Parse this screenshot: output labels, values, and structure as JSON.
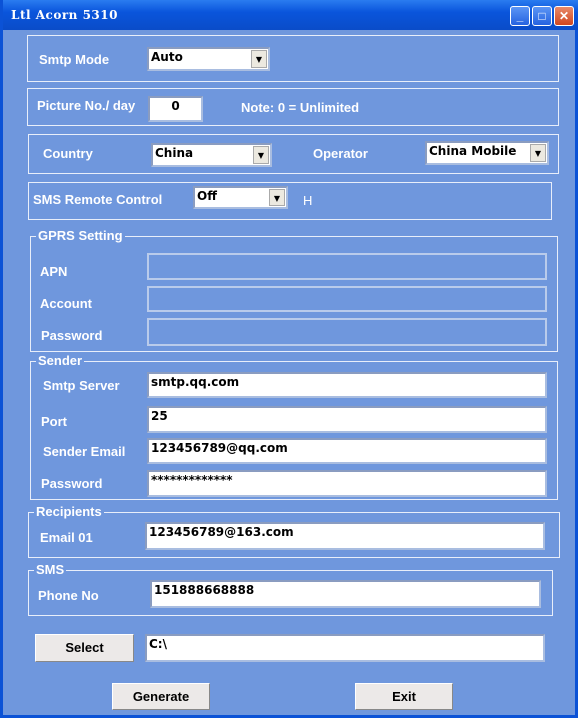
{
  "window": {
    "title": "Ltl Acorn 5310",
    "controls": [
      "minimize",
      "maximize",
      "close"
    ]
  },
  "smtp_mode": {
    "label": "Smtp Mode",
    "value": "Auto"
  },
  "picture": {
    "label": "Picture No./ day",
    "value": "0",
    "note": "Note: 0 = Unlimited"
  },
  "country": {
    "label": "Country",
    "value": "China"
  },
  "operator": {
    "label": "Operator",
    "value": "China Mobile"
  },
  "sms_remote": {
    "label": "SMS Remote Control",
    "value": "Off",
    "suffix": "H"
  },
  "gprs": {
    "legend": "GPRS Setting",
    "apn_label": "APN",
    "apn": "",
    "account_label": "Account",
    "account": "",
    "password_label": "Password",
    "password": ""
  },
  "sender": {
    "legend": "Sender",
    "server_label": "Smtp Server",
    "server": "smtp.qq.com",
    "port_label": "Port",
    "port": "25",
    "email_label": "Sender Email",
    "email": "123456789@qq.com",
    "password_label": "Password",
    "password": "*************"
  },
  "recipients": {
    "legend": "Recipients",
    "email_label": "Email 01",
    "email": "123456789@163.com"
  },
  "sms": {
    "legend": "SMS",
    "phone_label": "Phone No",
    "phone": "151888668888"
  },
  "path": {
    "button": "Select",
    "value": "C:\\"
  },
  "actions": {
    "generate": "Generate",
    "exit": "Exit"
  }
}
